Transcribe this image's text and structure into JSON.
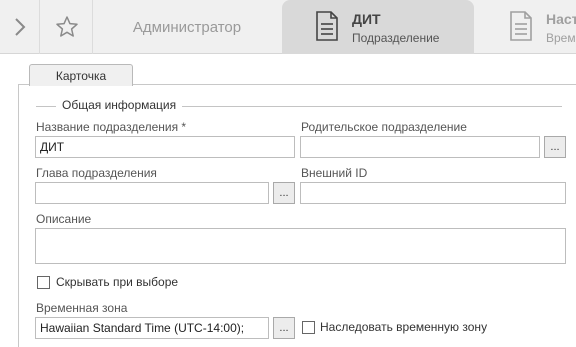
{
  "topbar": {
    "admin_label": "Администратор",
    "active_tab": {
      "title": "ДИТ",
      "subtitle": "Подразделение"
    },
    "next_tab": {
      "title": "Наст",
      "subtitle": "Време"
    }
  },
  "card": {
    "tab_label": "Карточка",
    "section_title": "Общая информация"
  },
  "form": {
    "name_label": "Название подразделения  *",
    "name_value": "ДИТ",
    "parent_label": "Родительское подразделение",
    "parent_value": "",
    "head_label": "Глава подразделения",
    "head_value": "",
    "external_id_label": "Внешний ID",
    "external_id_value": "",
    "description_label": "Описание",
    "description_value": "",
    "hide_label": "Скрывать при выборе",
    "hide_checked": false,
    "timezone_label": "Временная зона",
    "timezone_value": "Hawaiian Standard Time (UTC-14:00);",
    "inherit_tz_label": "Наследовать временную зону",
    "inherit_tz_checked": false,
    "lookup_button": "..."
  },
  "icons": {
    "expand": "chevron-right-icon",
    "favorite": "star-icon",
    "document": "document-icon"
  }
}
